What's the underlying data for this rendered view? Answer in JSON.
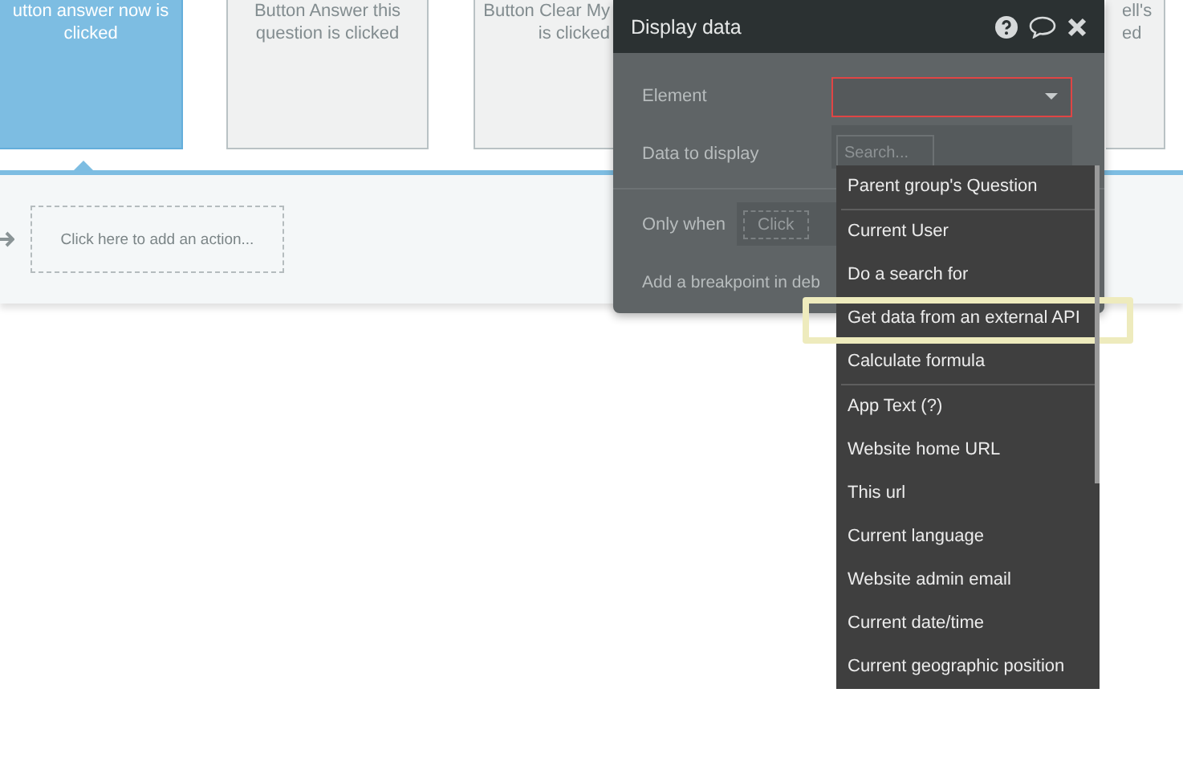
{
  "cards": [
    {
      "lines": [
        "utton answer now is",
        "clicked"
      ],
      "selected": true
    },
    {
      "lines": [
        "Button Answer this",
        "question is clicked"
      ],
      "selected": false
    },
    {
      "lines": [
        "Button Clear My",
        "is clicked"
      ],
      "selected": false
    },
    {
      "lines": [
        "ell's",
        "ed"
      ],
      "selected": false
    }
  ],
  "action_placeholder": "Click here to add an action...",
  "panel": {
    "title": "Display data",
    "element_label": "Element",
    "data_label": "Data to display",
    "search_placeholder": "Search...",
    "only_when_label": "Only when",
    "only_when_value": "Click",
    "breakpoint_label": "Add a breakpoint in deb"
  },
  "dropdown": [
    {
      "label": "Parent group's Question",
      "divider_after": true,
      "highlighted": false
    },
    {
      "label": "Current User",
      "divider_after": false,
      "highlighted": false
    },
    {
      "label": "Do a search for",
      "divider_after": false,
      "highlighted": false
    },
    {
      "label": "Get data from an external API",
      "divider_after": false,
      "highlighted": true
    },
    {
      "label": "Calculate formula",
      "divider_after": true,
      "highlighted": false
    },
    {
      "label": "App Text (?)",
      "divider_after": false,
      "highlighted": false
    },
    {
      "label": "Website home URL",
      "divider_after": false,
      "highlighted": false
    },
    {
      "label": "This url",
      "divider_after": false,
      "highlighted": false
    },
    {
      "label": "Current language",
      "divider_after": false,
      "highlighted": false
    },
    {
      "label": "Website admin email",
      "divider_after": false,
      "highlighted": false
    },
    {
      "label": "Current date/time",
      "divider_after": false,
      "highlighted": false
    },
    {
      "label": "Current geographic position",
      "divider_after": false,
      "highlighted": false
    }
  ]
}
